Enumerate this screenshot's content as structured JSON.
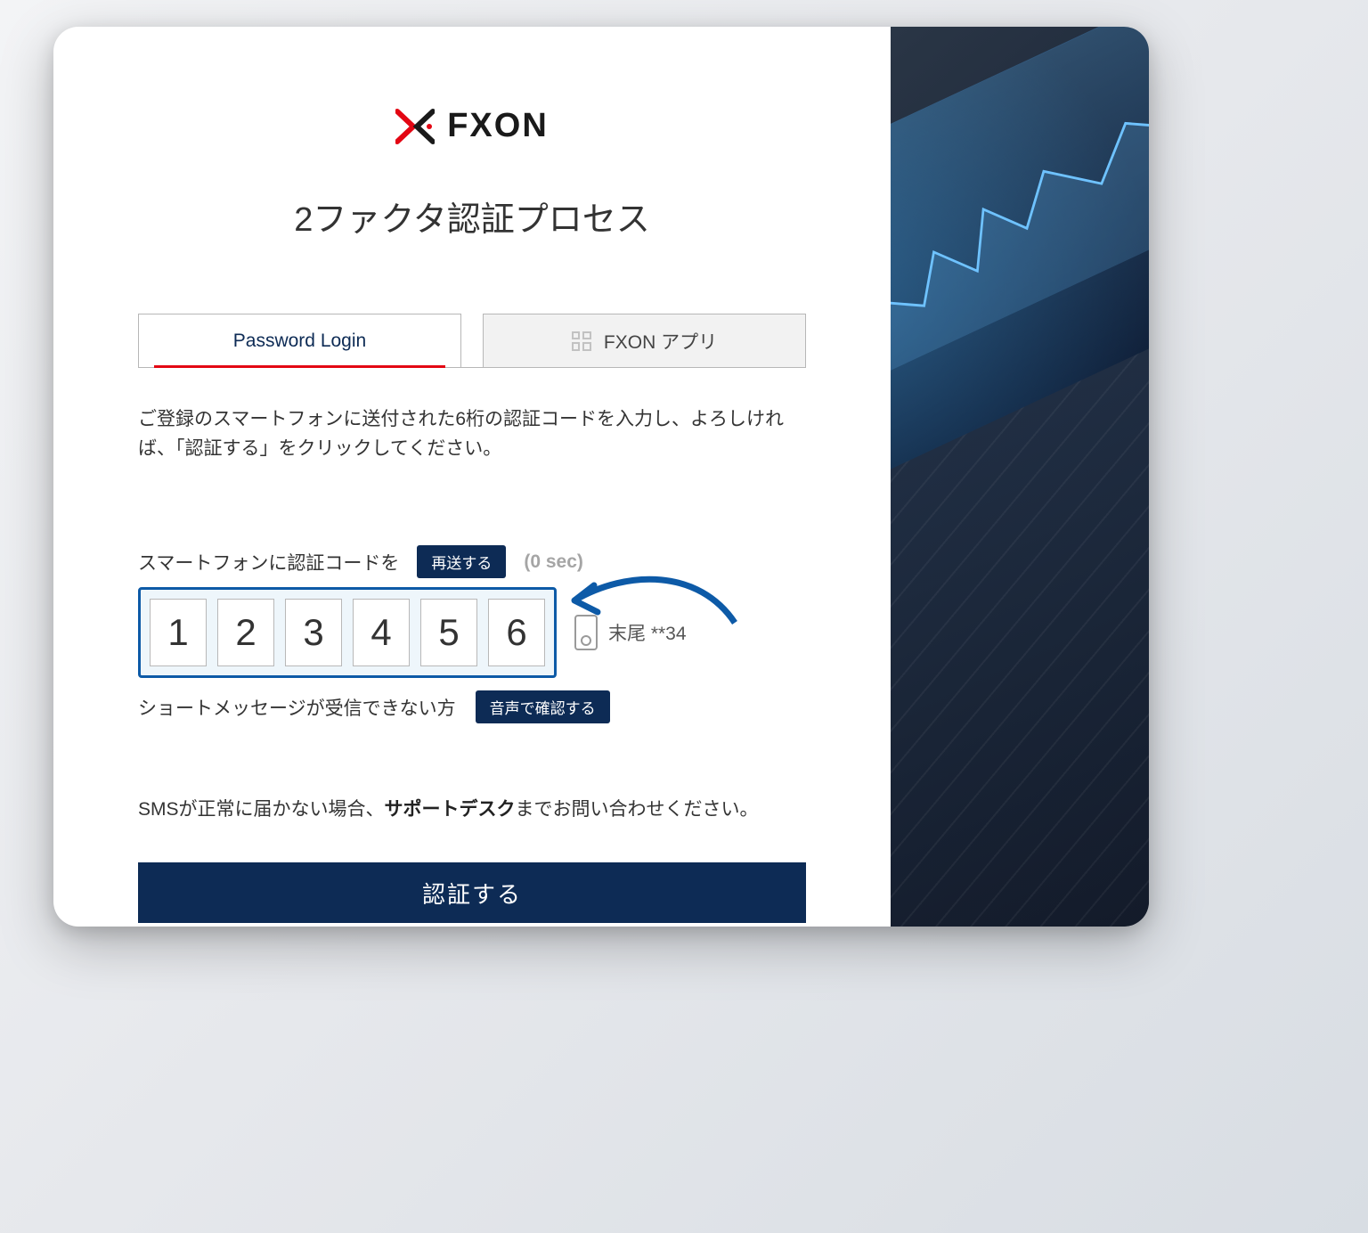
{
  "brand": {
    "name": "FXON"
  },
  "title": "2ファクタ認証プロセス",
  "tabs": {
    "password": "Password Login",
    "app": "FXON アプリ"
  },
  "instructions": "ご登録のスマートフォンに送付された6桁の認証コードを入力し、よろしければ、「認証する」をクリックしてください。",
  "resend": {
    "label": "スマートフォンに認証コードを",
    "button": "再送する",
    "timer": "(0 sec)"
  },
  "code": {
    "digits": [
      "1",
      "2",
      "3",
      "4",
      "5",
      "6"
    ],
    "device_label": "末尾 **34"
  },
  "voice": {
    "label": "ショートメッセージが受信できない方",
    "button": "音声で確認する"
  },
  "support": {
    "prefix": "SMSが正常に届かない場合、",
    "link": "サポートデスク",
    "suffix": "までお問い合わせください。"
  },
  "submit": "認証する"
}
